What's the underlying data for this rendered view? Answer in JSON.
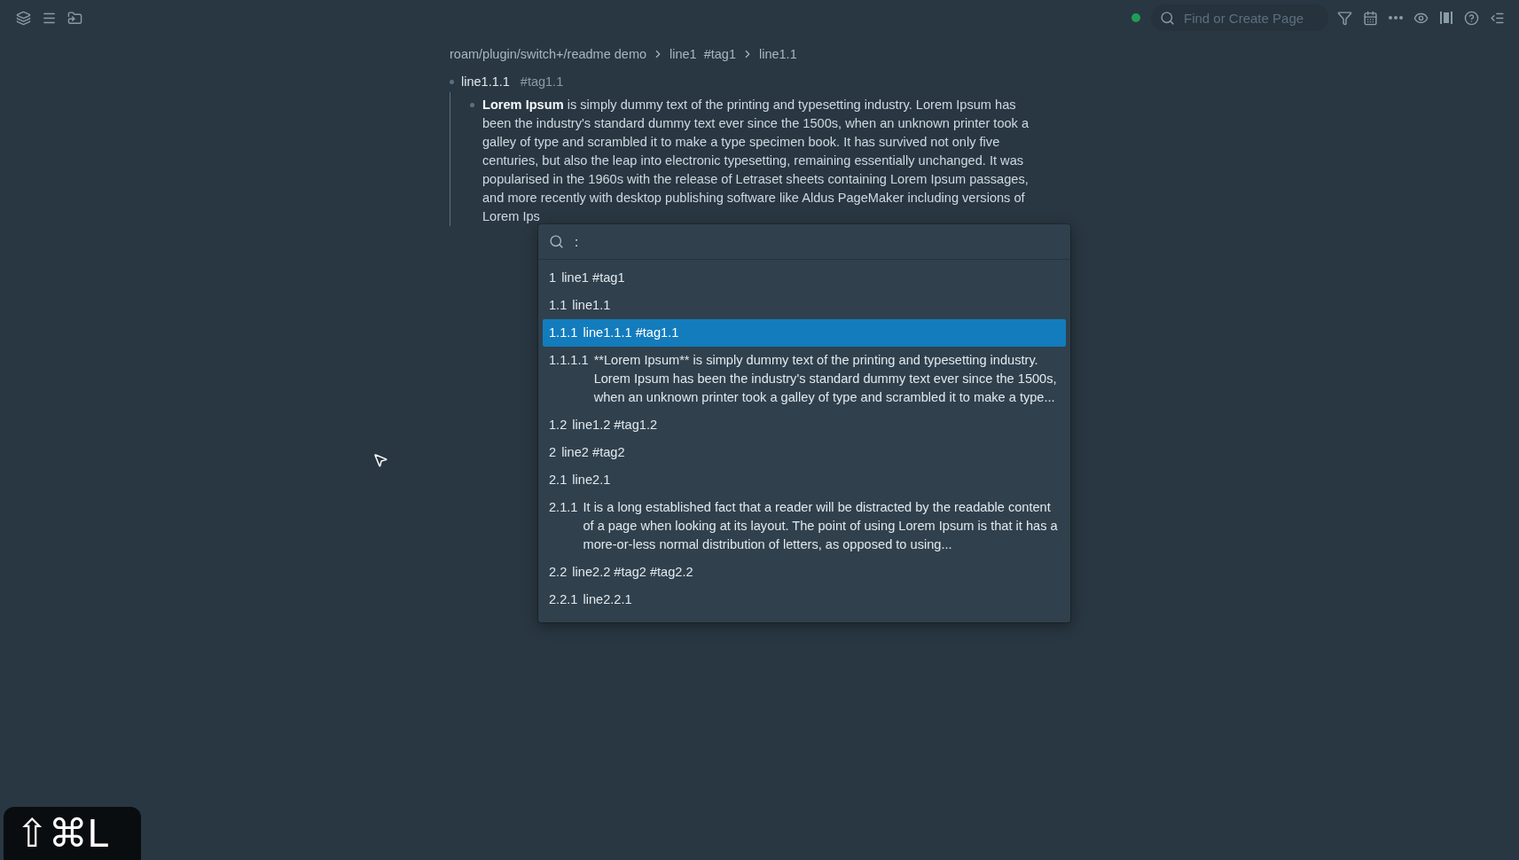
{
  "topbar": {
    "search": {
      "placeholder": "Find or Create Page"
    }
  },
  "breadcrumb": [
    {
      "text": "roam/plugin/switch+/readme demo"
    },
    {
      "text": "line1",
      "tag": "#tag1"
    },
    {
      "text": "line1.1"
    }
  ],
  "block": {
    "text": "line1.1.1",
    "tag": "#tag1.1",
    "children": [
      {
        "text": "**Lorem Ipsum** is simply dummy text of the printing and typesetting industry. Lorem Ipsum has been the industry's standard dummy text ever since the 1500s, when an unknown printer took a galley of type and scrambled it to make a type specimen book. It has survived not only five centuries, but also the leap into electronic typesetting, remaining essentially unchanged. It was popularised in the 1960s with the release of Letraset sheets containing Lorem Ipsum passages, and more recently with desktop publishing software like Aldus PageMaker including versions of Lorem Ips"
      }
    ]
  },
  "palette": {
    "query": ":",
    "items": [
      {
        "number": "1",
        "text": "line1 #tag1",
        "selected": false
      },
      {
        "number": "1.1",
        "text": "line1.1",
        "selected": false
      },
      {
        "number": "1.1.1",
        "text": "line1.1.1 #tag1.1",
        "selected": true
      },
      {
        "number": "1.1.1.1",
        "text": "**Lorem Ipsum** is simply dummy text of the printing and typesetting industry. Lorem Ipsum has been the industry's standard dummy text ever since the 1500s, when an unknown printer took a galley of type and scrambled it to make a type...",
        "selected": false
      },
      {
        "number": "1.2",
        "text": "line1.2 #tag1.2",
        "selected": false
      },
      {
        "number": "2",
        "text": "line2 #tag2",
        "selected": false
      },
      {
        "number": "2.1",
        "text": "line2.1",
        "selected": false
      },
      {
        "number": "2.1.1",
        "text": "It is a long established fact that a reader will be distracted by the readable content of a page when looking at its layout. The point of using Lorem Ipsum is that it has a more-or-less normal distribution of letters, as opposed to using...",
        "selected": false
      },
      {
        "number": "2.2",
        "text": "line2.2 #tag2 #tag2.2",
        "selected": false
      },
      {
        "number": "2.2.1",
        "text": "line2.2.1",
        "selected": false
      }
    ]
  },
  "shortcut_overlay": {
    "keys": "⇧⌘L"
  }
}
